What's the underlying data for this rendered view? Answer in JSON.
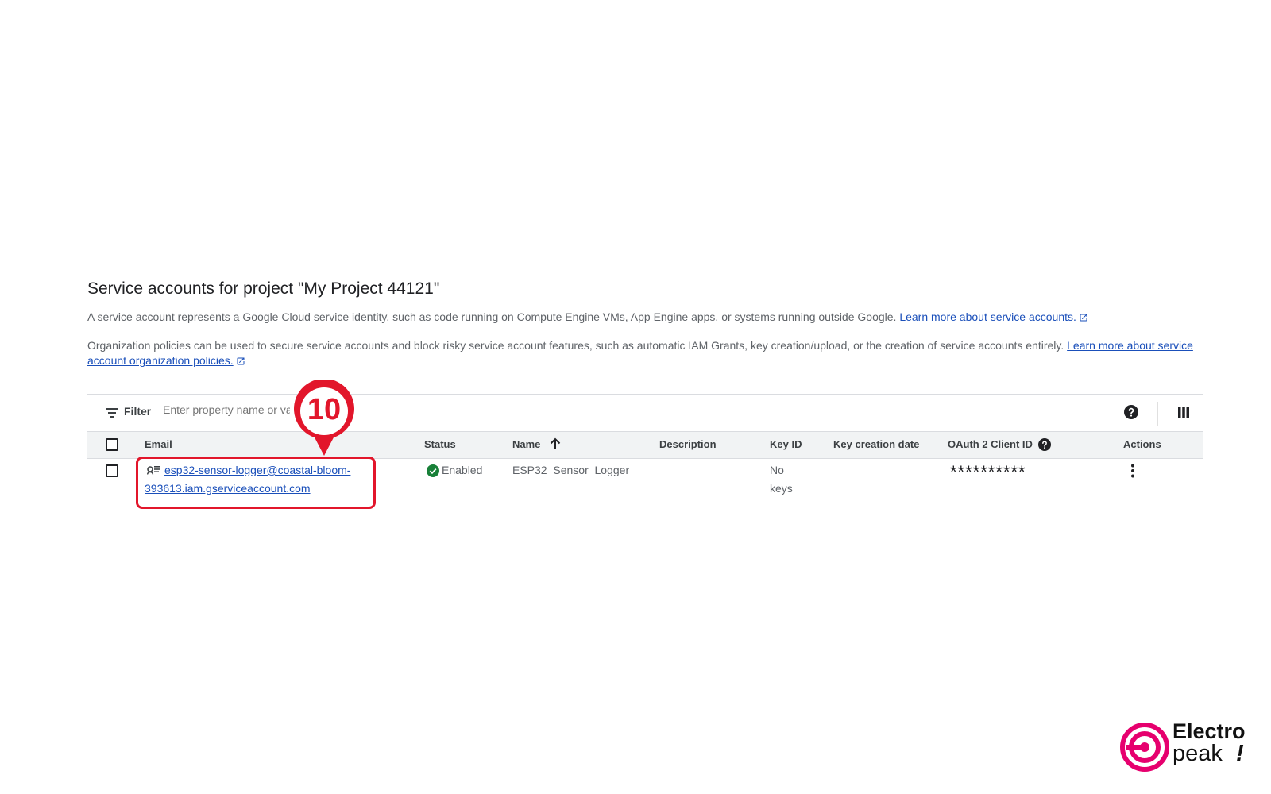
{
  "header": {
    "title": "Service accounts for project \"My Project 44121\"",
    "description1": "A service account represents a Google Cloud service identity, such as code running on Compute Engine VMs, App Engine apps, or systems running outside Google.",
    "description1_link": "Learn more about service accounts.",
    "description2": "Organization policies can be used to secure service accounts and block risky service account features, such as automatic IAM Grants, key creation/upload, or the creation of service accounts entirely.",
    "description2_link": "Learn more about service account organization policies."
  },
  "filter": {
    "label": "Filter",
    "placeholder": "Enter property name or value"
  },
  "table": {
    "columns": [
      "Email",
      "Status",
      "Name",
      "Description",
      "Key ID",
      "Key creation date",
      "OAuth 2 Client ID",
      "Actions"
    ],
    "rows": [
      {
        "email_line1": "esp32-sensor-logger@coastal-bloom-",
        "email_line2": "393613.iam.gserviceaccount.com",
        "status": "Enabled",
        "name": "ESP32_Sensor_Logger",
        "description": "",
        "key_id_line1": "No",
        "key_id_line2": "keys",
        "key_creation_date": "",
        "oauth_client_id": "**********"
      }
    ]
  },
  "annotation": {
    "step_number": "10",
    "color": "#e2162b"
  },
  "logo": {
    "line1": "Electro",
    "line2": "peak",
    "mark": "!",
    "color": "#e6006e"
  },
  "icons": {
    "filter": "filter-icon",
    "help": "help-icon",
    "columns": "columns-icon",
    "sort": "arrow-up-icon",
    "status": "check-circle-icon",
    "service_account": "service-account-icon",
    "more": "more-vert-icon",
    "external": "external-link-icon"
  }
}
